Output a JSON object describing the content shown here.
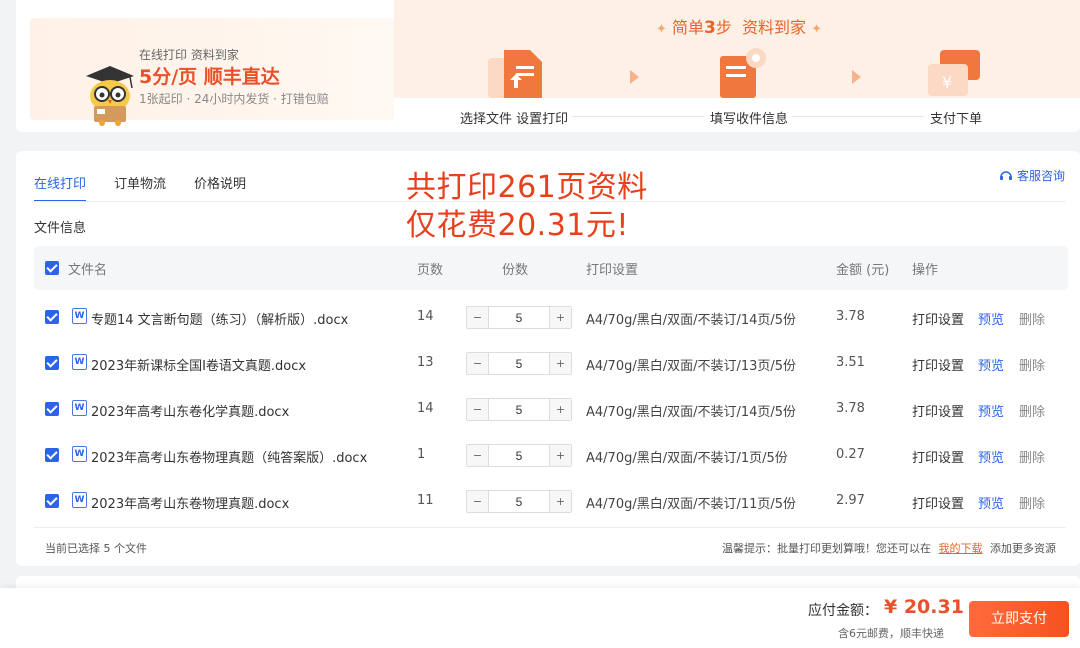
{
  "colors": {
    "accent": "#2b64e8",
    "brand_orange": "#e8512b",
    "overlay_red": "#e8401c"
  },
  "promo": {
    "line1": "在线打印 资料到家",
    "line2": "5分/页  顺丰直达",
    "line3": "1张起印 · 24小时内发货 · 打错包赔",
    "mascot_icon": "owl-mascot-icon"
  },
  "steps": {
    "title_pre": "简单",
    "title_num": "3",
    "title_mid": "步",
    "title_post": "资料到家",
    "items": [
      {
        "label": "选择文件 设置打印",
        "icon": "upload-file-icon"
      },
      {
        "label": "填写收件信息",
        "icon": "address-form-icon"
      },
      {
        "label": "支付下单",
        "icon": "payment-card-icon"
      }
    ]
  },
  "tabs": [
    {
      "label": "在线打印",
      "active": true
    },
    {
      "label": "订单物流",
      "active": false
    },
    {
      "label": "价格说明",
      "active": false
    }
  ],
  "service_label": "客服咨询",
  "overlay": {
    "line1": "共打印261页资料",
    "line2": "仅花费20.31元!"
  },
  "section_title": "文件信息",
  "table": {
    "headers": {
      "name": "文件名",
      "pages": "页数",
      "copies": "份数",
      "settings": "打印设置",
      "amount": "金额 (元)",
      "ops": "操作"
    },
    "rows": [
      {
        "name": "专题14 文言断句题（练习）（解析版）.docx",
        "pages": "14",
        "copies": "5",
        "settings": "A4/70g/黑白/双面/不装订/14页/5份",
        "amount": "3.78"
      },
      {
        "name": "2023年新课标全国Ⅰ卷语文真题.docx",
        "pages": "13",
        "copies": "5",
        "settings": "A4/70g/黑白/双面/不装订/13页/5份",
        "amount": "3.51"
      },
      {
        "name": "2023年高考山东卷化学真题.docx",
        "pages": "14",
        "copies": "5",
        "settings": "A4/70g/黑白/双面/不装订/14页/5份",
        "amount": "3.78"
      },
      {
        "name": "2023年高考山东卷物理真题（纯答案版）.docx",
        "pages": "1",
        "copies": "5",
        "settings": "A4/70g/黑白/双面/不装订/1页/5份",
        "amount": "0.27"
      },
      {
        "name": "2023年高考山东卷物理真题.docx",
        "pages": "11",
        "copies": "5",
        "settings": "A4/70g/黑白/双面/不装订/11页/5份",
        "amount": "2.97"
      }
    ],
    "ops": {
      "settings": "打印设置",
      "preview": "预览",
      "delete": "删除"
    },
    "minus": "−",
    "plus": "+"
  },
  "footer": {
    "selected": "当前已选择 5 个文件",
    "tip_pre": "温馨提示：批量打印更划算哦！您还可以在",
    "tip_link": "我的下载",
    "tip_post": "添加更多资源"
  },
  "pay": {
    "label": "应付金额：",
    "amount": "¥ 20.31",
    "note": "含6元邮费，顺丰快递",
    "button": "立即支付"
  }
}
